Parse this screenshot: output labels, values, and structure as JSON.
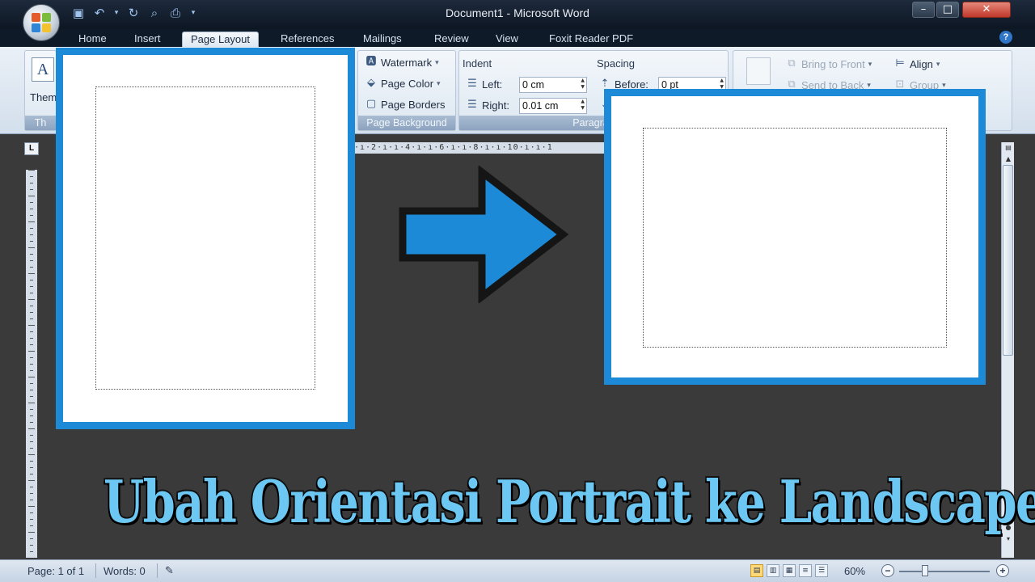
{
  "window": {
    "title": "Document1 - Microsoft Word",
    "minimize": "–",
    "maximize": "□",
    "close": "✕"
  },
  "qat": {
    "save_icon": "save-icon",
    "undo_icon": "undo-icon",
    "redo_icon": "redo-icon",
    "print_preview_icon": "print-preview-icon",
    "quick_print_icon": "quick-print-icon"
  },
  "tabs": [
    {
      "label": "Home"
    },
    {
      "label": "Insert"
    },
    {
      "label": "Page Layout",
      "active": true
    },
    {
      "label": "References"
    },
    {
      "label": "Mailings"
    },
    {
      "label": "Review"
    },
    {
      "label": "View"
    },
    {
      "label": "Foxit Reader PDF"
    }
  ],
  "ribbon": {
    "themes": {
      "button_label": "Them",
      "group_label": "Th"
    },
    "page_background": {
      "group_label": "Page Background",
      "watermark": "Watermark",
      "page_color": "Page Color",
      "page_borders": "Page Borders"
    },
    "paragraph": {
      "group_label": "Paragrap",
      "indent_heading": "Indent",
      "left_label": "Left:",
      "left_value": "0 cm",
      "right_label": "Right:",
      "right_value": "0.01 cm",
      "spacing_heading": "Spacing",
      "before_label": "Before:",
      "before_value": "0 pt"
    },
    "arrange": {
      "bring_to_front": "Bring to Front",
      "send_to_back": "Send to Back",
      "align": "Align",
      "group": "Group"
    }
  },
  "ruler": {
    "corner_glyph": "L",
    "text": "·ı·2·ı·ı·4·ı·ı·6·ı·ı·8·ı·ı·10·ı·ı·1"
  },
  "headline": "Ubah Orientasi Portrait ke Landscape",
  "status": {
    "page": "Page: 1 of 1",
    "words": "Words: 0",
    "zoom": "60%"
  },
  "colors": {
    "page_frame": "#1c8ad6",
    "arrow_fill": "#1c8ad6",
    "headline": "#6cc7f2"
  }
}
